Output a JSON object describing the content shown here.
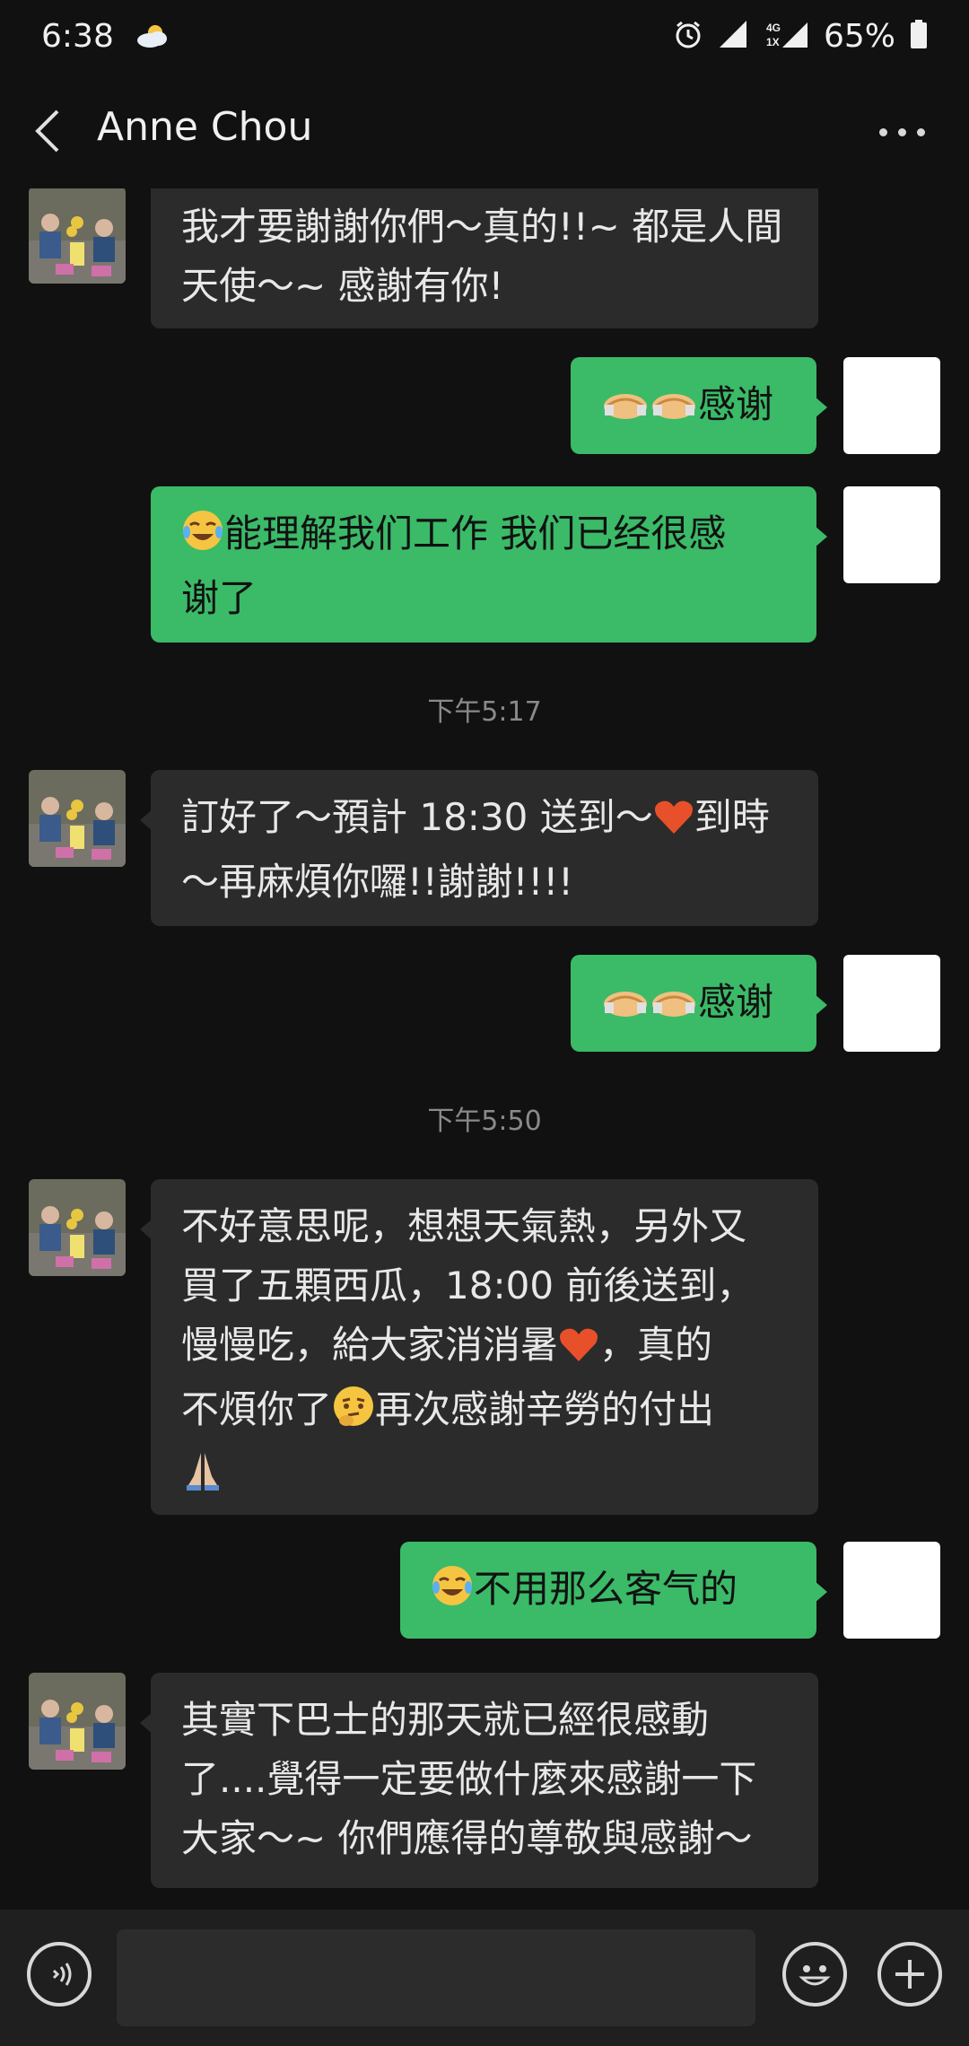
{
  "status_bar": {
    "time": "6:38",
    "battery": "65%",
    "network": "4G 1X"
  },
  "header": {
    "contact_name": "Anne Chou"
  },
  "messages": [
    {
      "side": "in",
      "text": "我才要謝謝你們～真的!!~ 都是人間天使～~ 感謝有你!"
    },
    {
      "side": "out",
      "text": "🤝🤝感谢"
    },
    {
      "side": "out",
      "text": "😂能理解我们工作 我们已经很感谢了"
    },
    {
      "side": "in",
      "text": "訂好了～預計 18:30 送到～❤️到時～再麻煩你囉!!謝謝!!!!"
    },
    {
      "side": "out",
      "text": "🤝🤝感谢"
    },
    {
      "side": "in",
      "text": "不好意思呢，想想天氣熱，另外又買了五顆西瓜，18:00 前後送到，慢慢吃，給大家消消暑❤️，真的不煩你了🤔再次感謝辛勞的付出🙏"
    },
    {
      "side": "out",
      "text": "😂不用那么客气的"
    },
    {
      "side": "in",
      "text": "其實下巴士的那天就已經很感動了....覺得一定要做什麼來感謝一下大家～~ 你們應得的尊敬與感謝～"
    }
  ],
  "timestamps": {
    "t1": "下午5:17",
    "t2": "下午5:50"
  },
  "lines": {
    "m1": [
      "我才要謝謝你們～真的!!~ 都是人間",
      "天使～~ 感謝有你!"
    ],
    "m3": [
      "能理解我们工作 我们已经很感",
      "谢了"
    ],
    "m4": [
      "訂好了～預計 18:30 送到～",
      "到時",
      "～再麻煩你囉!!謝謝!!!!"
    ],
    "m6": [
      "不好意思呢，想想天氣熱，另外又",
      "買了五顆西瓜，18:00 前後送到，",
      "慢慢吃，給大家消消暑",
      "，真的",
      "不煩你了",
      "再次感謝辛勞的付出"
    ],
    "m8": [
      "其實下巴士的那天就已經很感動",
      "了....覺得一定要做什麼來感謝一下",
      "大家～~ 你們應得的尊敬與感謝～"
    ],
    "thanks": "感谢",
    "no_need": "不用那么客气的"
  },
  "colors": {
    "background": "#111111",
    "incoming_bubble": "#2b2b2b",
    "outgoing_bubble": "#3bba68"
  },
  "icons": {
    "back": "chevron-left-icon",
    "more": "more-dots-icon",
    "voice": "voice-icon",
    "emoji": "smiley-icon",
    "plus": "plus-icon"
  }
}
